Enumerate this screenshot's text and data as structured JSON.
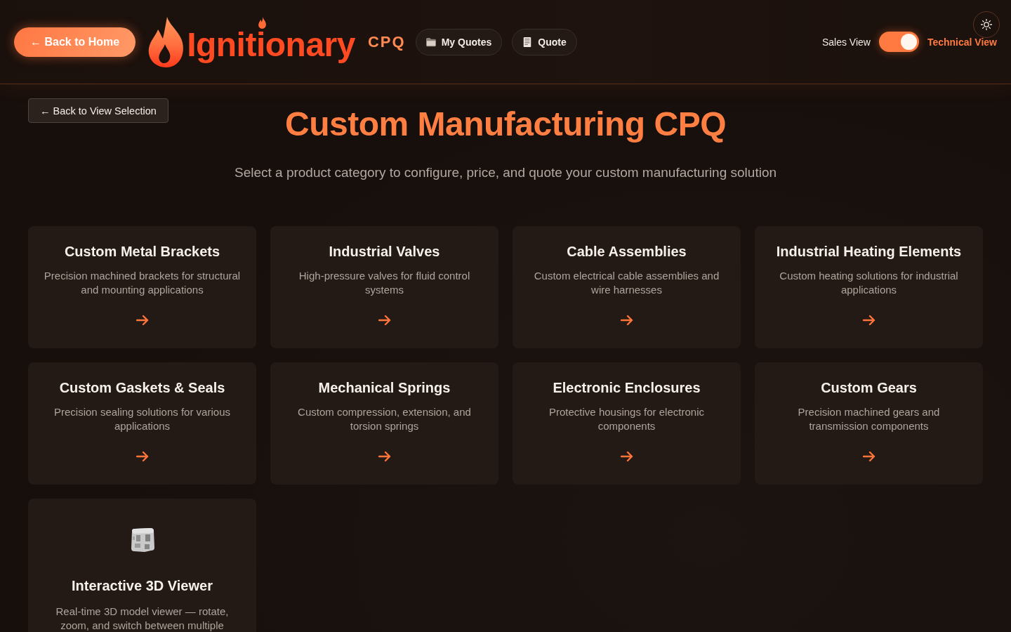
{
  "header": {
    "back_button": "← Back to Home",
    "logo_text": "Ignitionary",
    "logo_suffix": "CPQ",
    "nav": [
      {
        "label": "My Quotes",
        "kind": "folder"
      },
      {
        "label": "Quote",
        "kind": "document"
      }
    ],
    "view_toggle": {
      "left_label": "Sales View",
      "right_label": "Technical View",
      "on": true
    }
  },
  "page": {
    "back_button": "← Back to View Selection",
    "title": "Custom Manufacturing CPQ",
    "subtitle": "Select a product category to configure, price, and quote your custom manufacturing solution"
  },
  "cards": [
    {
      "kind": "category",
      "title": "Custom Metal Brackets",
      "description": "Precision machined brackets for structural and mounting applications"
    },
    {
      "kind": "category",
      "title": "Industrial Valves",
      "description": "High-pressure valves for fluid control systems"
    },
    {
      "kind": "category",
      "title": "Cable Assemblies",
      "description": "Custom electrical cable assemblies and wire harnesses"
    },
    {
      "kind": "category",
      "title": "Industrial Heating Elements",
      "description": "Custom heating solutions for industrial applications"
    },
    {
      "kind": "category",
      "title": "Custom Gaskets & Seals",
      "description": "Precision sealing solutions for various applications"
    },
    {
      "kind": "category",
      "title": "Mechanical Springs",
      "description": "Custom compression, extension, and torsion springs"
    },
    {
      "kind": "category",
      "title": "Electronic Enclosures",
      "description": "Protective housings for electronic components"
    },
    {
      "kind": "category",
      "title": "Custom Gears",
      "description": "Precision machined gears and transmission components"
    },
    {
      "kind": "viewer",
      "title": "Interactive 3D Viewer",
      "description": "Real-time 3D model viewer — rotate, zoom, and switch between multiple"
    }
  ]
}
